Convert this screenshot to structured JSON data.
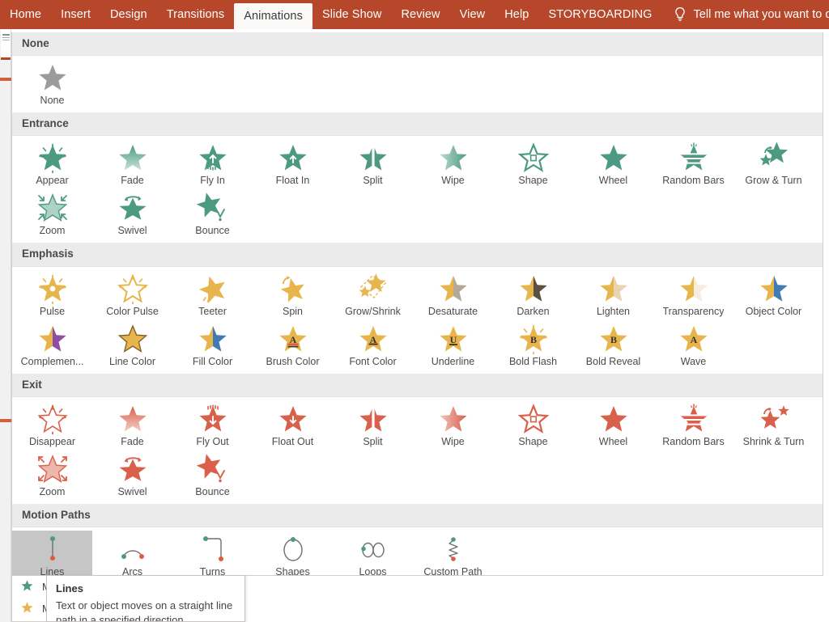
{
  "ribbon": {
    "tabs": [
      {
        "label": "Home",
        "active": false
      },
      {
        "label": "Insert",
        "active": false
      },
      {
        "label": "Design",
        "active": false
      },
      {
        "label": "Transitions",
        "active": false
      },
      {
        "label": "Animations",
        "active": true
      },
      {
        "label": "Slide Show",
        "active": false
      },
      {
        "label": "Review",
        "active": false
      },
      {
        "label": "View",
        "active": false
      },
      {
        "label": "Help",
        "active": false
      },
      {
        "label": "STORYBOARDING",
        "active": false
      }
    ],
    "tellme": {
      "icon": "lightbulb-icon",
      "label": "Tell me what you want to do"
    },
    "accent_color": "#b7472a"
  },
  "gallery": {
    "sections": [
      {
        "id": "none",
        "title": "None",
        "color": "#9b9b9b",
        "items": [
          {
            "label": "None",
            "icon": "star-plain"
          }
        ]
      },
      {
        "id": "entrance",
        "title": "Entrance",
        "color": "#4c9a82",
        "items": [
          {
            "label": "Appear",
            "icon": "star-burst"
          },
          {
            "label": "Fade",
            "icon": "star-fade"
          },
          {
            "label": "Fly In",
            "icon": "star-arrow-up"
          },
          {
            "label": "Float In",
            "icon": "star-arrow-up-small"
          },
          {
            "label": "Split",
            "icon": "star-split"
          },
          {
            "label": "Wipe",
            "icon": "star-wipe"
          },
          {
            "label": "Shape",
            "icon": "star-outline-box"
          },
          {
            "label": "Wheel",
            "icon": "star-plain"
          },
          {
            "label": "Random Bars",
            "icon": "star-bars"
          },
          {
            "label": "Grow & Turn",
            "icon": "star-grow-turn"
          },
          {
            "label": "Zoom",
            "icon": "star-zoom-in"
          },
          {
            "label": "Swivel",
            "icon": "star-swivel"
          },
          {
            "label": "Bounce",
            "icon": "star-bounce"
          }
        ]
      },
      {
        "id": "emphasis",
        "title": "Emphasis",
        "color": "#e8b54d",
        "items": [
          {
            "label": "Pulse",
            "icon": "star-pulse"
          },
          {
            "label": "Color Pulse",
            "icon": "star-color-pulse"
          },
          {
            "label": "Teeter",
            "icon": "star-teeter"
          },
          {
            "label": "Spin",
            "icon": "star-spin"
          },
          {
            "label": "Grow/Shrink",
            "icon": "star-grow-shrink"
          },
          {
            "label": "Desaturate",
            "icon": "star-half-gray"
          },
          {
            "label": "Darken",
            "icon": "star-half-dark"
          },
          {
            "label": "Lighten",
            "icon": "star-half-light"
          },
          {
            "label": "Transparency",
            "icon": "star-half-pale"
          },
          {
            "label": "Object Color",
            "icon": "star-half-blue"
          },
          {
            "label": "Complemen...",
            "icon": "star-half-purple"
          },
          {
            "label": "Line Color",
            "icon": "star-outline-gray"
          },
          {
            "label": "Fill Color",
            "icon": "star-half-blue"
          },
          {
            "label": "Brush Color",
            "icon": "star-letter-a-brush"
          },
          {
            "label": "Font Color",
            "icon": "star-letter-a"
          },
          {
            "label": "Underline",
            "icon": "star-letter-u"
          },
          {
            "label": "Bold Flash",
            "icon": "star-letter-b-flash"
          },
          {
            "label": "Bold Reveal",
            "icon": "star-letter-b"
          },
          {
            "label": "Wave",
            "icon": "star-letter-a-wave"
          }
        ]
      },
      {
        "id": "exit",
        "title": "Exit",
        "color": "#d9604a",
        "items": [
          {
            "label": "Disappear",
            "icon": "star-outline-burst"
          },
          {
            "label": "Fade",
            "icon": "star-fade"
          },
          {
            "label": "Fly Out",
            "icon": "star-arrow-down"
          },
          {
            "label": "Float Out",
            "icon": "star-arrow-down-small"
          },
          {
            "label": "Split",
            "icon": "star-split"
          },
          {
            "label": "Wipe",
            "icon": "star-wipe"
          },
          {
            "label": "Shape",
            "icon": "star-outline-box"
          },
          {
            "label": "Wheel",
            "icon": "star-plain"
          },
          {
            "label": "Random Bars",
            "icon": "star-bars"
          },
          {
            "label": "Shrink & Turn",
            "icon": "star-shrink-turn"
          },
          {
            "label": "Zoom",
            "icon": "star-zoom-out"
          },
          {
            "label": "Swivel",
            "icon": "star-swivel"
          },
          {
            "label": "Bounce",
            "icon": "star-bounce"
          }
        ]
      },
      {
        "id": "motion-paths",
        "title": "Motion Paths",
        "color": "#6f6f6f",
        "items": [
          {
            "label": "Lines",
            "icon": "path-line",
            "selected": true
          },
          {
            "label": "Arcs",
            "icon": "path-arc"
          },
          {
            "label": "Turns",
            "icon": "path-turn"
          },
          {
            "label": "Shapes",
            "icon": "path-shape"
          },
          {
            "label": "Loops",
            "icon": "path-loop"
          },
          {
            "label": "Custom Path",
            "icon": "path-custom"
          }
        ]
      }
    ]
  },
  "menu_below": {
    "items": [
      {
        "label": "More Entrance Effects...",
        "icon": "star-green"
      },
      {
        "label": "More Emphasis Effects...",
        "icon": "star-gold"
      }
    ]
  },
  "tooltip": {
    "title": "Lines",
    "body": "Text or object moves on a straight line path in a specified direction."
  },
  "path_colors": {
    "start_dot": "#4c9a82",
    "end_dot": "#e05a45",
    "stroke": "#6f6f6f"
  }
}
